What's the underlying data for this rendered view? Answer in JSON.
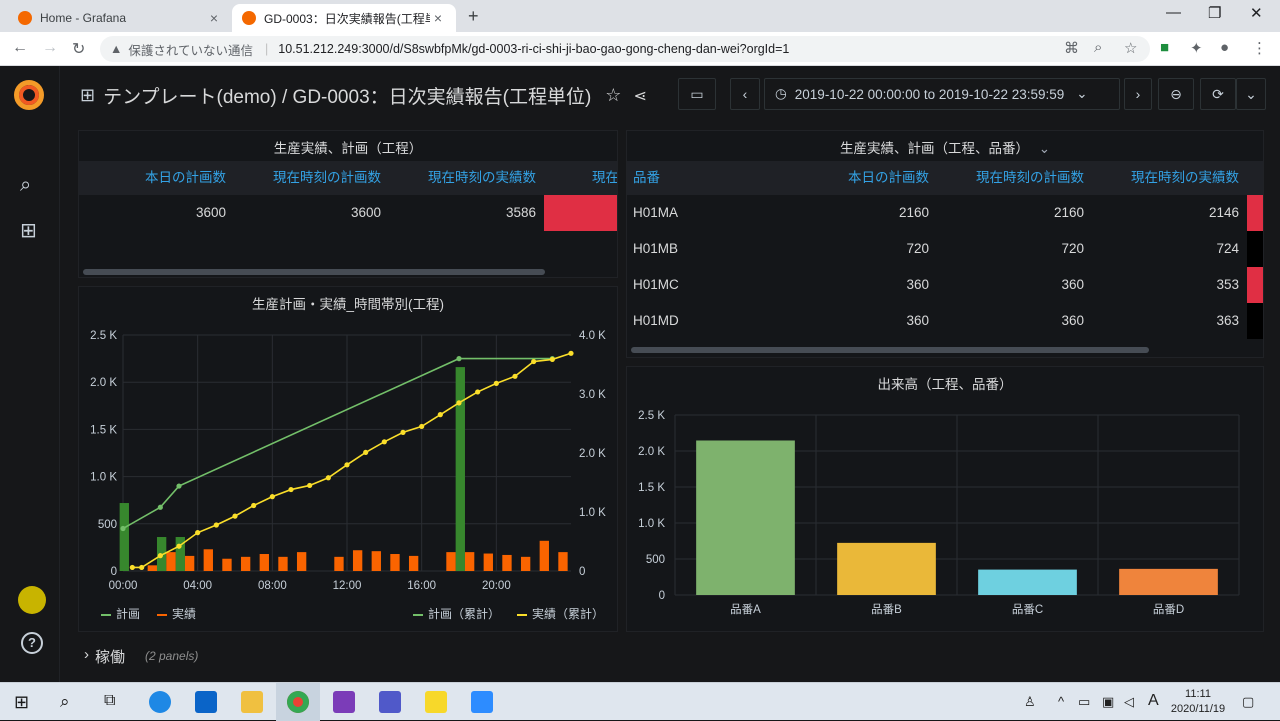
{
  "browser": {
    "tabs": [
      {
        "title": "Home - Grafana",
        "close": "×"
      },
      {
        "title": "GD-0003：日次実績報告(工程単",
        "close": "×"
      }
    ],
    "new_tab": "+",
    "security_label": "保護されていない通信",
    "url_host": "10.51.212.249",
    "url_rest": ":3000/d/S8swbfpMk/gd-0003-ri-ci-shi-ji-bao-gao-gong-cheng-dan-wei?orgId=1"
  },
  "dashboard": {
    "title": "テンプレート(demo) / GD-0003：日次実績報告(工程単位)",
    "time_range": "2019-10-22 00:00:00 to 2019-10-22 23:59:59"
  },
  "panel1": {
    "title": "生産実績、計画（工程）",
    "headers": [
      "本日の計画数",
      "現在時刻の計画数",
      "現在時刻の実績数",
      "現在"
    ],
    "row": [
      "3600",
      "3600",
      "3586"
    ],
    "status_color": "#e02f44"
  },
  "panel2": {
    "title": "生産実績、計画（工程、品番）",
    "title_caret": "⌄",
    "headers": [
      "品番",
      "本日の計画数",
      "現在時刻の計画数",
      "現在時刻の実績数"
    ],
    "rows": [
      {
        "part": "H01MA",
        "plan_today": "2160",
        "plan_now": "2160",
        "actual_now": "2146",
        "status": "#e02f44"
      },
      {
        "part": "H01MB",
        "plan_today": "720",
        "plan_now": "720",
        "actual_now": "724",
        "status": "#000000"
      },
      {
        "part": "H01MC",
        "plan_today": "360",
        "plan_now": "360",
        "actual_now": "353",
        "status": "#e02f44"
      },
      {
        "part": "H01MD",
        "plan_today": "360",
        "plan_now": "360",
        "actual_now": "363",
        "status": "#000000"
      }
    ]
  },
  "panel3": {
    "title": "生産計画・実績_時間帯別(工程)",
    "legend": {
      "plan": "計画",
      "actual": "実績",
      "plan_cum": "計画（累計）",
      "actual_cum": "実績（累計）"
    }
  },
  "panel4": {
    "title": "出来高（工程、品番）"
  },
  "collapsed_row": {
    "title": "稼働",
    "caret": "›",
    "count": "(2 panels)"
  },
  "taskbar": {
    "time": "11:11",
    "date": "2020/11/19",
    "ime": "A"
  },
  "colors": {
    "plan_green": "#37872d",
    "plan_line": "#73bf69",
    "actual_orange": "#fa6400",
    "cum_yellow": "#fade2a",
    "link_blue": "#33a2e5"
  },
  "chart_data": [
    {
      "type": "bar",
      "title": "生産計画・実績_時間帯別(工程)",
      "x_ticks": [
        "00:00",
        "04:00",
        "08:00",
        "12:00",
        "16:00",
        "20:00"
      ],
      "y_left_ticks": [
        "0",
        "500",
        "1.0 K",
        "1.5 K",
        "2.0 K",
        "2.5 K"
      ],
      "y_right_ticks": [
        "0",
        "1.0 K",
        "2.0 K",
        "3.0 K",
        "4.0 K"
      ],
      "y_left_range": [
        0,
        2500
      ],
      "y_right_range": [
        0,
        4000
      ],
      "hours": [
        0,
        1,
        2,
        3,
        4,
        5,
        6,
        7,
        8,
        9,
        10,
        11,
        12,
        13,
        14,
        15,
        16,
        17,
        18,
        19,
        20,
        21,
        22,
        23
      ],
      "series": [
        {
          "name": "計画",
          "axis": "left",
          "kind": "bar",
          "values": [
            720,
            0,
            360,
            360,
            0,
            0,
            0,
            0,
            0,
            0,
            0,
            0,
            0,
            0,
            0,
            0,
            0,
            0,
            2160,
            0,
            0,
            0,
            0,
            0
          ]
        },
        {
          "name": "実績",
          "axis": "left",
          "kind": "bar",
          "values": [
            0,
            60,
            200,
            160,
            230,
            130,
            150,
            180,
            150,
            200,
            0,
            150,
            220,
            210,
            180,
            160,
            0,
            200,
            200,
            185,
            170,
            150,
            320,
            200
          ]
        },
        {
          "name": "計画（累計）",
          "axis": "right",
          "kind": "line",
          "points": [
            [
              0,
              720
            ],
            [
              2,
              1080
            ],
            [
              3,
              1440
            ],
            [
              18,
              3600
            ],
            [
              23,
              3600
            ]
          ]
        },
        {
          "name": "実績（累計）",
          "axis": "right",
          "kind": "line",
          "points": [
            [
              0.5,
              60
            ],
            [
              1,
              60
            ],
            [
              2,
              260
            ],
            [
              3,
              420
            ],
            [
              4,
              650
            ],
            [
              5,
              780
            ],
            [
              6,
              930
            ],
            [
              7,
              1110
            ],
            [
              8,
              1260
            ],
            [
              9,
              1380
            ],
            [
              10,
              1450
            ],
            [
              11,
              1580
            ],
            [
              12,
              1800
            ],
            [
              13,
              2010
            ],
            [
              14,
              2190
            ],
            [
              15,
              2350
            ],
            [
              16,
              2450
            ],
            [
              17,
              2650
            ],
            [
              18,
              2850
            ],
            [
              19,
              3035
            ],
            [
              20,
              3180
            ],
            [
              21,
              3300
            ],
            [
              22,
              3550
            ],
            [
              23,
              3586
            ],
            [
              24,
              3690
            ]
          ]
        }
      ]
    },
    {
      "type": "bar",
      "title": "出来高（工程、品番）",
      "categories": [
        "品番A",
        "品番B",
        "品番C",
        "品番D"
      ],
      "values": [
        2146,
        724,
        353,
        363
      ],
      "colors": [
        "#7eb26d",
        "#eab839",
        "#6ed0e0",
        "#ef843c"
      ],
      "y_ticks": [
        "0",
        "500",
        "1.0 K",
        "1.5 K",
        "2.0 K",
        "2.5 K"
      ],
      "ylim": [
        0,
        2500
      ]
    }
  ]
}
